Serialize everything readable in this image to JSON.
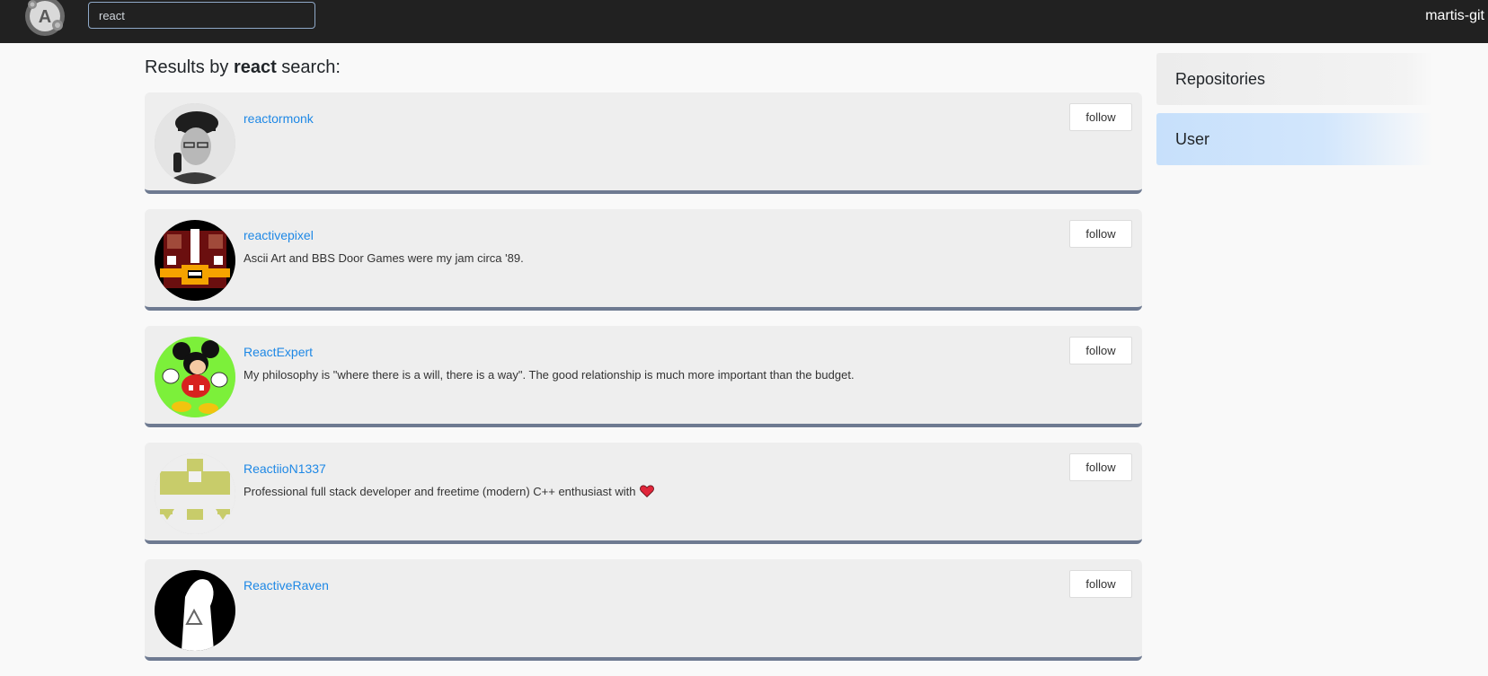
{
  "navbar": {
    "logo_letter": "A",
    "search": {
      "value": "react",
      "placeholder": ""
    },
    "username": "martis-git"
  },
  "page": {
    "heading_prefix": "Results by ",
    "heading_term": "react",
    "heading_suffix": " search:"
  },
  "results": [
    {
      "login": "reactormonk",
      "bio": "",
      "follow_label": "follow",
      "avatar_icon": "photo-avatar"
    },
    {
      "login": "reactivepixel",
      "bio": "Ascii Art and BBS Door Games were my jam circa '89.",
      "follow_label": "follow",
      "avatar_icon": "pixel-chest-avatar"
    },
    {
      "login": "ReactExpert",
      "bio": "My philosophy is \"where there is a will, there is a way\". The good relationship is much more important than the budget.",
      "follow_label": "follow",
      "avatar_icon": "cartoon-mouse-avatar"
    },
    {
      "login": "ReactiioN1337",
      "bio": "Professional full stack developer and freetime (modern) C++ enthusiast with",
      "follow_label": "follow",
      "avatar_icon": "identicon-avatar",
      "bio_emoji": "heart-icon"
    },
    {
      "login": "ReactiveRaven",
      "bio": "",
      "follow_label": "follow",
      "avatar_icon": "silhouette-avatar"
    }
  ],
  "sidebar": {
    "tabs": [
      {
        "label": "Repositories",
        "active": false
      },
      {
        "label": "User",
        "active": true
      }
    ]
  },
  "colors": {
    "navbar": "#212121",
    "link": "#1e88e5",
    "card": "#eeeeee",
    "card_border": "#6e7a91",
    "active_tab": "#c7e0fb"
  }
}
